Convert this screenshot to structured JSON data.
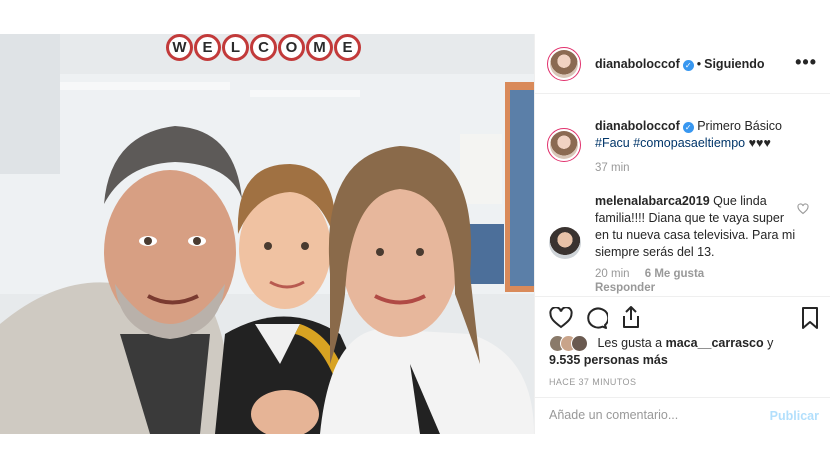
{
  "post": {
    "username": "dianaboloccof",
    "follow_status": "Siguiendo",
    "photo_sign": [
      "W",
      "E",
      "L",
      "C",
      "O",
      "M",
      "E"
    ],
    "caption": {
      "username": "dianaboloccof",
      "text": "Primero Básico",
      "hashtag1": "#Facu",
      "hashtag2": "#comopasaeltiempo",
      "hearts": "♥♥♥",
      "time": "37 min"
    },
    "comment": {
      "username": "melenalabarca2019",
      "text": "Que linda familia!!!! Diana que te vaya super en tu nueva casa televisiva. Para mi siempre serás del 13.",
      "time": "20 min",
      "likes": "6 Me gusta",
      "reply": "Responder"
    },
    "likes_text_prefix": "Les gusta a",
    "likes_user": "maca__carrasco",
    "likes_and": "y",
    "likes_count": "9.535 personas más",
    "posted_ago": "HACE 37 MINUTOS",
    "comment_placeholder": "Añade un comentario...",
    "publish_label": "Publicar"
  },
  "colors": {
    "link": "#003569",
    "verified": "#3897f0",
    "publish_disabled": "#b2dffc",
    "muted": "#999999"
  },
  "icons": [
    "verified-icon",
    "more-options-icon",
    "heart-icon",
    "comment-icon",
    "share-icon",
    "bookmark-icon",
    "comment-like-icon"
  ]
}
